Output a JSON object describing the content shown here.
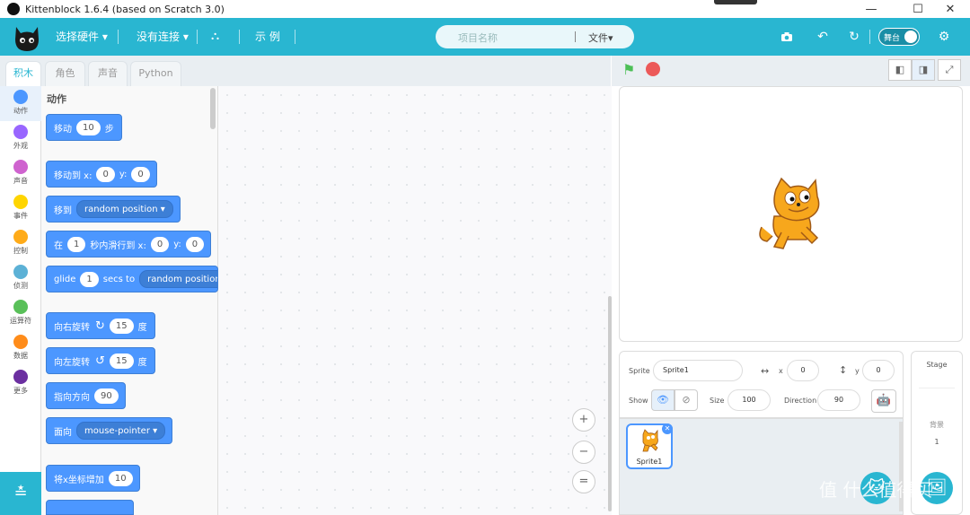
{
  "window": {
    "title": "Kittenblock 1.6.4 (based on Scratch 3.0)",
    "min_label": "—",
    "max_label": "☐",
    "close_label": "✕"
  },
  "menu": {
    "hardware": "选择硬件 ▾",
    "connection": "没有连接 ▾",
    "examples": "示 例",
    "project_placeholder": "项目名称",
    "file": "文件▾",
    "stage_toggle": "舞台"
  },
  "tabs": [
    "积木",
    "角色",
    "声音",
    "Python"
  ],
  "categories": [
    {
      "label": "动作",
      "color": "#4c97ff"
    },
    {
      "label": "外观",
      "color": "#9966ff"
    },
    {
      "label": "声音",
      "color": "#cf63cf"
    },
    {
      "label": "事件",
      "color": "#ffd500"
    },
    {
      "label": "控制",
      "color": "#ffab19"
    },
    {
      "label": "侦测",
      "color": "#5cb1d6"
    },
    {
      "label": "运算符",
      "color": "#59c059"
    },
    {
      "label": "数据",
      "color": "#ff8c1a"
    },
    {
      "label": "更多",
      "color": "#6b2fa0"
    }
  ],
  "palette": {
    "section": "动作",
    "blocks": {
      "move": {
        "a": "移动",
        "n": "10",
        "b": "步"
      },
      "goto_xy": {
        "a": "移动到 x:",
        "x": "0",
        "b": "y:",
        "y": "0"
      },
      "goto": {
        "a": "移到",
        "dd": "random position ▾"
      },
      "glide_xy": {
        "a": "在",
        "s": "1",
        "b": "秒内滑行到 x:",
        "x": "0",
        "c": "y:",
        "y": "0"
      },
      "glide": {
        "a": "glide",
        "s": "1",
        "b": "secs to",
        "dd": "random position ▾"
      },
      "turn_right": {
        "a": "向右旋转",
        "icon": "↻",
        "n": "15",
        "b": "度"
      },
      "turn_left": {
        "a": "向左旋转",
        "icon": "↺",
        "n": "15",
        "b": "度"
      },
      "point_dir": {
        "a": "指向方向",
        "n": "90"
      },
      "point_towards": {
        "a": "面向",
        "dd": "mouse-pointer ▾"
      },
      "change_x": {
        "a": "将x坐标增加",
        "n": "10"
      }
    }
  },
  "zoom": {
    "in": "+",
    "out": "−",
    "reset": "="
  },
  "sprite_info": {
    "sprite_label": "Sprite",
    "sprite_name": "Sprite1",
    "x_label": "x",
    "x_value": "0",
    "y_label": "y",
    "y_value": "0",
    "show_label": "Show",
    "size_label": "Size",
    "size_value": "100",
    "direction_label": "Direction",
    "direction_value": "90"
  },
  "sprite_list": [
    {
      "name": "Sprite1"
    }
  ],
  "stage_panel": {
    "title": "Stage",
    "backdrops_label": "背景",
    "backdrops_count": "1"
  },
  "watermark": "值 什么值得买"
}
